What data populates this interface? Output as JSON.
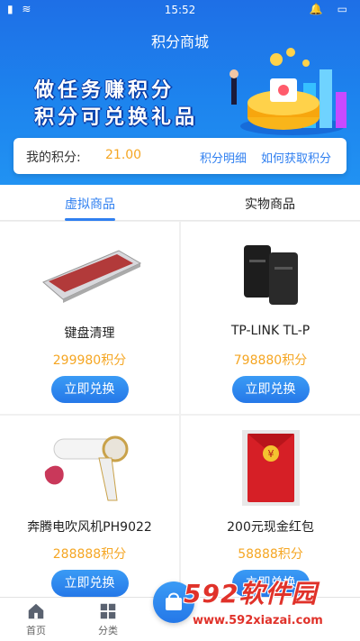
{
  "status": {
    "time": "15:52"
  },
  "header": {
    "title": "积分商城"
  },
  "banner": {
    "line1": "做任务赚积分",
    "line2": "积分可兑换礼品"
  },
  "points": {
    "label": "我的积分:",
    "value": "21.00",
    "detail_link": "积分明细",
    "how_link": "如何获取积分"
  },
  "tabs": [
    {
      "label": "虚拟商品",
      "active": true
    },
    {
      "label": "实物商品",
      "active": false
    }
  ],
  "products": [
    {
      "name": "键盘清理",
      "price": "299980积分",
      "button": "立即兑换",
      "icon": "keyboard-image"
    },
    {
      "name": "TP-LINK TL-P",
      "price": "798880积分",
      "button": "立即兑换",
      "icon": "powerline-adapter-image"
    },
    {
      "name": "奔腾电吹风机PH9022",
      "price": "288888积分",
      "button": "立即兑换",
      "icon": "hair-dryer-image"
    },
    {
      "name": "200元现金红包",
      "price": "58888积分",
      "button": "立即兑换",
      "icon": "red-envelope-image"
    }
  ],
  "bottom_nav": [
    {
      "label": "首页",
      "icon": "home-icon"
    },
    {
      "label": "分类",
      "icon": "grid-icon"
    }
  ],
  "watermark": {
    "brand": "592软件园",
    "url": "www.592xiazai.com"
  },
  "colors": {
    "primary": "#2f7ff0",
    "points": "#f5a623",
    "header": "#1e6fe6"
  }
}
